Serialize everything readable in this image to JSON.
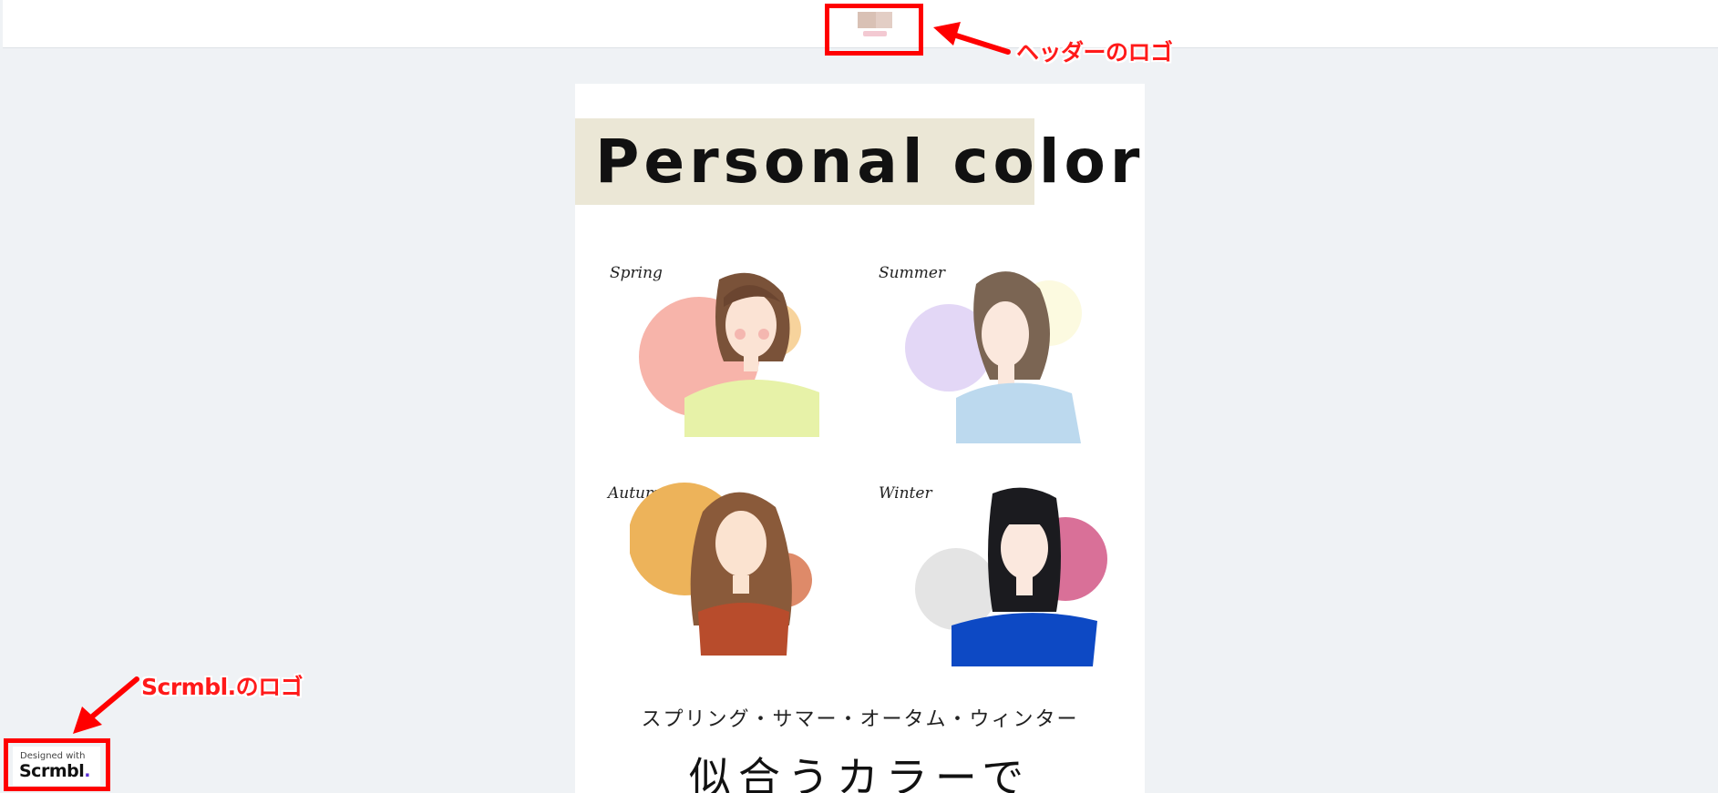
{
  "annotations": {
    "header_logo_callout": "ヘッダーのロゴ",
    "scrmbl_logo_callout": "Scrmbl.のロゴ"
  },
  "card": {
    "title": "Personal color",
    "seasons": [
      {
        "label": "Spring"
      },
      {
        "label": "Summer"
      },
      {
        "label": "Autumn"
      },
      {
        "label": "Winter"
      }
    ],
    "subtitle": "スプリング・サマー・オータム・ウィンター",
    "heading": "似合うカラーで"
  },
  "scrmbl": {
    "small": "Designed with",
    "brand": "Scrmbl",
    "dot": "."
  },
  "colors": {
    "annotation_red": "#ff0000",
    "page_background": "#eff2f5",
    "title_band": "#ebe7d6"
  }
}
